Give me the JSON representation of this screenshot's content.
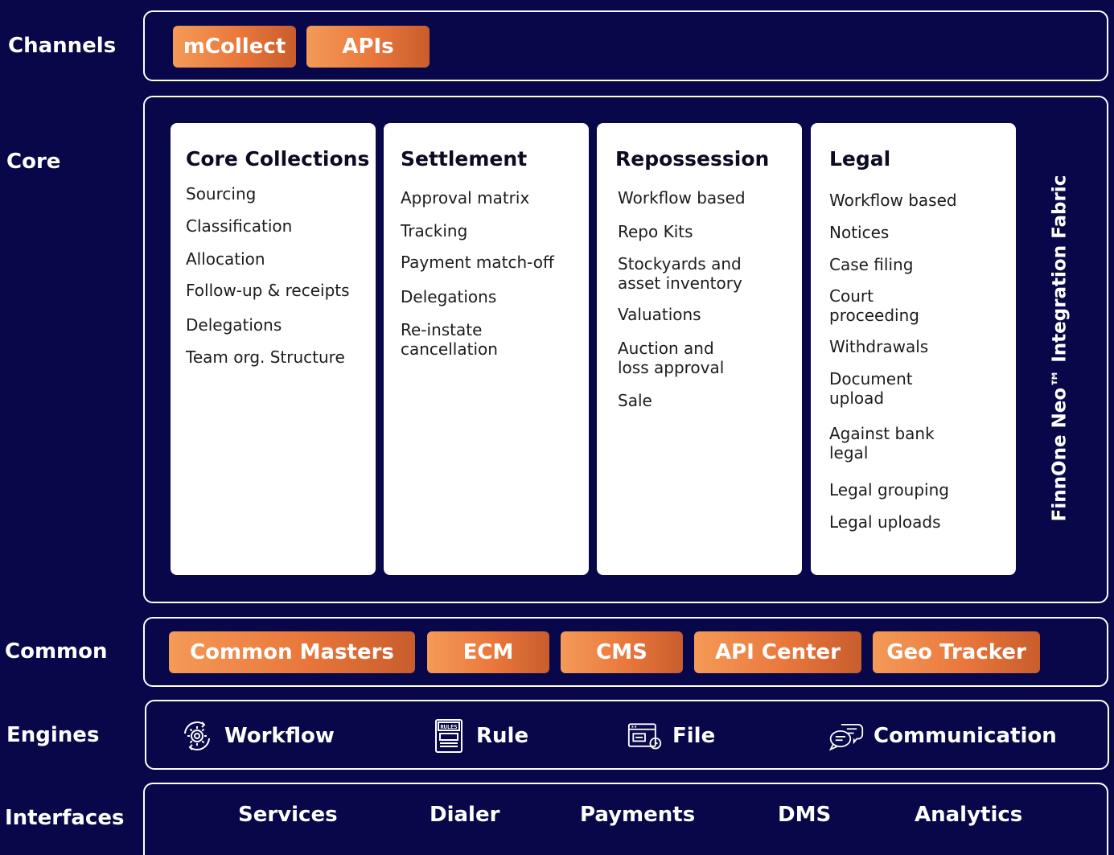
{
  "rows": {
    "channels": "Channels",
    "core": "Core",
    "common": "Common",
    "engines": "Engines",
    "interfaces": "Interfaces"
  },
  "channels": [
    "mCollect",
    "APIs"
  ],
  "cards": [
    {
      "title": "Core Collections",
      "items": [
        "Sourcing",
        "Classification",
        "Allocation",
        "Follow-up & receipts",
        "Delegations",
        "Team org. Structure"
      ]
    },
    {
      "title": "Settlement",
      "items": [
        "Approval matrix",
        "Tracking",
        "Payment match-off",
        "Delegations",
        "Re-instate cancellation"
      ]
    },
    {
      "title": "Repossession",
      "items": [
        "Workflow based",
        "Repo Kits",
        "Stockyards and asset inventory",
        "Valuations",
        "Auction and loss approval",
        "Sale"
      ]
    },
    {
      "title": "Legal",
      "items": [
        "Workflow based",
        "Notices",
        "Case filing",
        "Court proceeding",
        "Withdrawals",
        "Document upload",
        "Against bank legal",
        "Legal grouping",
        "Legal uploads"
      ]
    }
  ],
  "fabric": "FinnOne Neo™ Integration Fabric",
  "common": [
    "Common Masters",
    "ECM",
    "CMS",
    "API Center",
    "Geo Tracker"
  ],
  "engines": [
    {
      "label": "Workflow",
      "icon": "gear-cycle-icon"
    },
    {
      "label": "Rule",
      "icon": "rules-book-icon",
      "icon_text": "RULES"
    },
    {
      "label": "File",
      "icon": "file-window-icon"
    },
    {
      "label": "Communication",
      "icon": "chat-bubbles-icon"
    }
  ],
  "interfaces": [
    "Services",
    "Dialer",
    "Payments",
    "DMS",
    "Analytics"
  ],
  "colors": {
    "background": "#07074a",
    "accent_start": "#f49a57",
    "accent_end": "#c85d2c",
    "card": "#ffffff"
  }
}
